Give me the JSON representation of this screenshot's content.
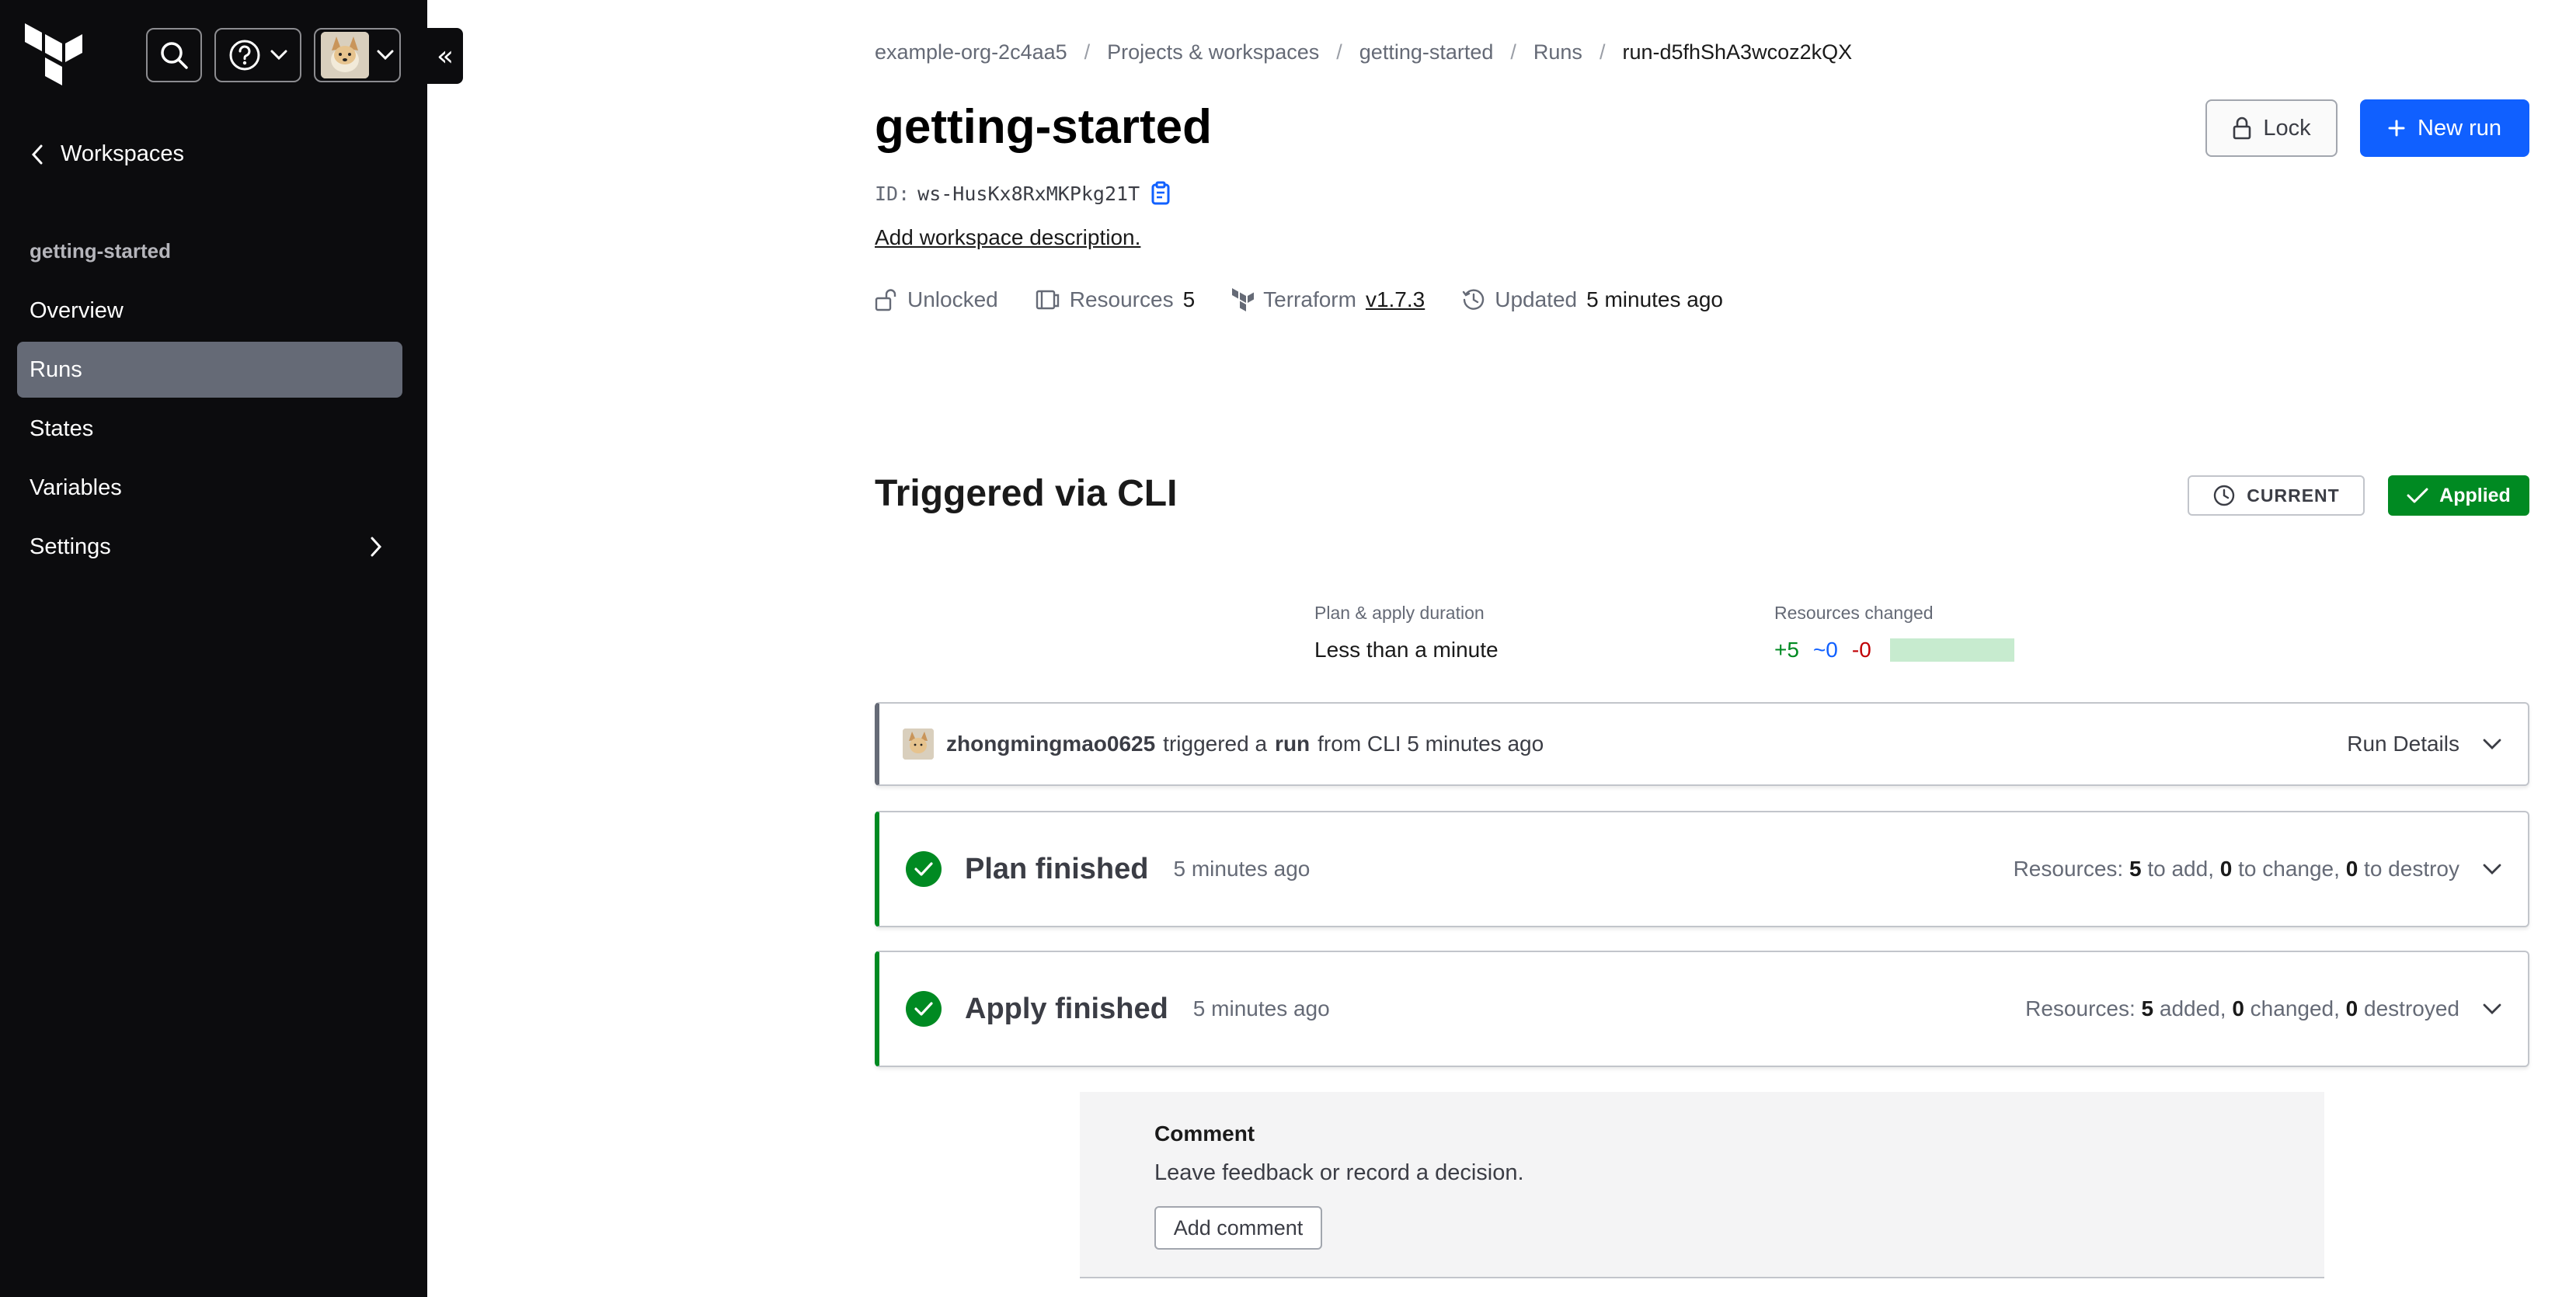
{
  "sidebar": {
    "back_label": "Workspaces",
    "workspace_heading": "getting-started",
    "items": [
      {
        "label": "Overview"
      },
      {
        "label": "Runs"
      },
      {
        "label": "States"
      },
      {
        "label": "Variables"
      },
      {
        "label": "Settings"
      }
    ],
    "active_item": "Runs",
    "collapse_glyph": "«"
  },
  "breadcrumb": {
    "org": "example-org-2c4aa5",
    "projects": "Projects & workspaces",
    "workspace": "getting-started",
    "runs": "Runs",
    "current": "run-d5fhShA3wcoz2kQX",
    "separator": "/"
  },
  "header": {
    "title": "getting-started",
    "id_label": "ID:",
    "id_value": "ws-HusKx8RxMKPkg21T",
    "add_description": "Add workspace description.",
    "lock_label": "Lock",
    "new_run_label": "New run"
  },
  "meta": {
    "lock_status": "Unlocked",
    "resources_label": "Resources",
    "resources_count": "5",
    "terraform_label": "Terraform",
    "terraform_version": "v1.7.3",
    "updated_label": "Updated",
    "updated_value": "5 minutes ago"
  },
  "run": {
    "title": "Triggered via CLI",
    "current_badge": "CURRENT",
    "status_badge": "Applied",
    "duration_label": "Plan & apply duration",
    "duration_value": "Less than a minute",
    "changes_label": "Resources changed",
    "added": "+5",
    "changed": "~0",
    "destroyed": "-0"
  },
  "trigger": {
    "user": "zhongmingmao0625",
    "text1": "triggered a",
    "run_word": "run",
    "text2": "from CLI 5 minutes ago",
    "details_label": "Run Details"
  },
  "plan": {
    "title": "Plan finished",
    "time": "5 minutes ago",
    "resources_prefix": "Resources:",
    "add": "5",
    "add_text": "to add,",
    "change": "0",
    "change_text": "to change,",
    "destroy": "0",
    "destroy_text": "to destroy"
  },
  "apply": {
    "title": "Apply finished",
    "time": "5 minutes ago",
    "resources_prefix": "Resources:",
    "added": "5",
    "added_text": "added,",
    "changed": "0",
    "changed_text": "changed,",
    "destroyed": "0",
    "destroyed_text": "destroyed"
  },
  "comment": {
    "title": "Comment",
    "subtitle": "Leave feedback or record a decision.",
    "button": "Add comment"
  },
  "colors": {
    "sidebar_bg": "#0c0c0e",
    "active_nav": "#656a76",
    "primary": "#1060ff",
    "success": "#008a22",
    "danger": "#c00005"
  }
}
